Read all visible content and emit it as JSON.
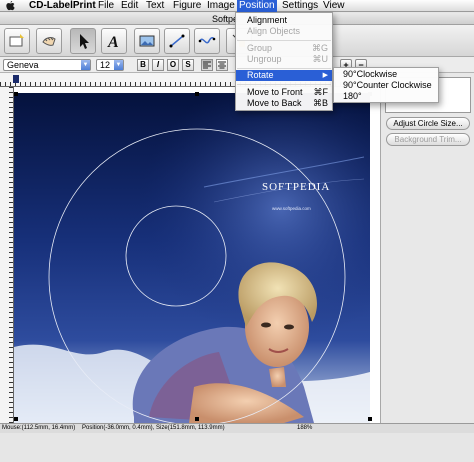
{
  "menubar": {
    "app": "CD-LabelPrint",
    "items": [
      "File",
      "Edit",
      "Text",
      "Figure",
      "Image",
      "Position",
      "Settings",
      "View"
    ],
    "active": "Position"
  },
  "window": {
    "title": "Softpe"
  },
  "toolbar": {
    "tools": [
      "new-label-icon",
      "hand-tool-icon",
      "pointer-tool-icon",
      "text-tool-icon",
      "image-tool-icon",
      "line-tool-icon",
      "curve-tool-icon"
    ]
  },
  "formatbar": {
    "font": "Geneva",
    "size": "12",
    "bold": "B",
    "italic": "I",
    "outline": "O",
    "shadow": "S"
  },
  "position_menu": {
    "items": [
      {
        "label": "Alignment",
        "shortcut": "",
        "disabled": false
      },
      {
        "label": "Align Objects",
        "shortcut": "",
        "disabled": true
      },
      {
        "label": "Group",
        "shortcut": "⌘G",
        "disabled": true
      },
      {
        "label": "Ungroup",
        "shortcut": "⌘U",
        "disabled": true
      },
      {
        "label": "Rotate",
        "shortcut": "",
        "disabled": false
      },
      {
        "label": "Move to Front",
        "shortcut": "⌘F",
        "disabled": false
      },
      {
        "label": "Move to Back",
        "shortcut": "⌘B",
        "disabled": false
      }
    ]
  },
  "rotate_submenu": {
    "items": [
      "90°Clockwise",
      "90°Counter Clockwise",
      "180°"
    ]
  },
  "right_panel": {
    "adjust_circle": "Adjust Circle Size...",
    "background_trim": "Background Trim...",
    "zoom_in": "+",
    "zoom_out": "−"
  },
  "canvas": {
    "brand": "SOFTPEDIA",
    "url": "www.softpedia.com"
  },
  "statusbar": {
    "mouse": "Mouse:(112.5mm, 16.4mm)",
    "position": "Position(-36.0mm, 0.4mm), Size(151.8mm, 113.9mm)",
    "zoom": "188%"
  },
  "colors": {
    "menu_highlight": "#2a5fd6",
    "canvas_dark": "#0b1c55",
    "canvas_mid": "#2e4c9e"
  }
}
